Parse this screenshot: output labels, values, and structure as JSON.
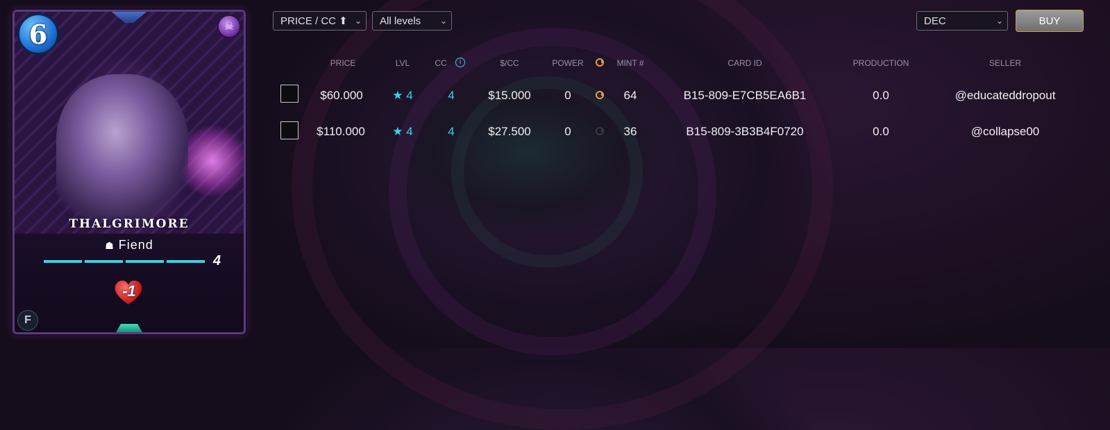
{
  "card": {
    "mana": "6",
    "name": "THALGRIMORE",
    "type": "Fiend",
    "level": "4",
    "health": "-1"
  },
  "toolbar": {
    "sort": "PRICE / CC ⬆",
    "levels": "All levels",
    "currency": "DEC",
    "buy_label": "BUY"
  },
  "table": {
    "headers": {
      "price": "PRICE",
      "lvl": "LVL",
      "cc": "CC",
      "per_cc": "$/CC",
      "power": "POWER",
      "mint": "MINT #",
      "card_id": "CARD ID",
      "production": "PRODUCTION",
      "seller": "SELLER"
    },
    "rows": [
      {
        "price": "$60.000",
        "lvl": "★ 4",
        "cc": "4",
        "per_cc": "$15.000",
        "power": "0",
        "mint": "64",
        "card_id": "B15-809-E7CB5EA6B1",
        "production": "0.0",
        "seller": "@educateddropout"
      },
      {
        "price": "$110.000",
        "lvl": "★ 4",
        "cc": "4",
        "per_cc": "$27.500",
        "power": "0",
        "mint": "36",
        "card_id": "B15-809-3B3B4F0720",
        "production": "0.0",
        "seller": "@collapse00"
      }
    ]
  }
}
